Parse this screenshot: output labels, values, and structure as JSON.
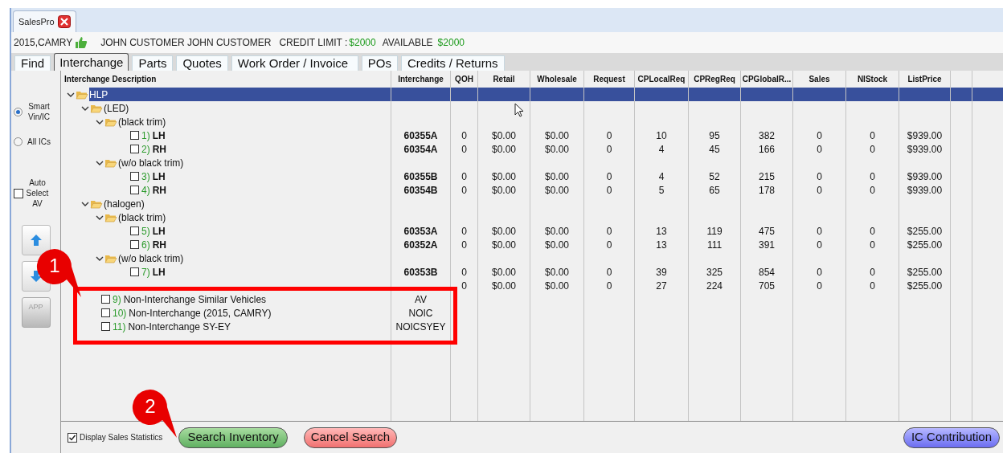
{
  "window_tab": {
    "title": "SalesPro"
  },
  "info_bar": {
    "vehicle": "2015,CAMRY",
    "customer": "JOHN CUSTOMER JOHN CUSTOMER",
    "credit_limit_label": "CREDIT LIMIT :",
    "credit_limit": "$2000",
    "available_label": "AVAILABLE",
    "available": "$2000"
  },
  "tabs": [
    {
      "label": "Find",
      "selected": false
    },
    {
      "label": "Interchange",
      "selected": true
    },
    {
      "label": "Parts",
      "selected": false
    },
    {
      "label": "Quotes",
      "selected": false
    },
    {
      "label": "Work Order / Invoice",
      "selected": false
    },
    {
      "label": "POs",
      "selected": false
    },
    {
      "label": "Credits / Returns",
      "selected": false
    }
  ],
  "sidebar": {
    "modes": [
      {
        "label": "Smart Vin/IC",
        "selected": true
      },
      {
        "label": "All ICs",
        "selected": false
      }
    ],
    "auto_select": {
      "label": "Auto Select AV",
      "checked": false
    },
    "buttons": [
      {
        "kind": "up"
      },
      {
        "kind": "down"
      },
      {
        "kind": "app",
        "label": "APP",
        "disabled": true
      }
    ]
  },
  "table": {
    "columns": [
      "Interchange Description",
      "Interchange",
      "QOH",
      "Retail",
      "Wholesale",
      "Request",
      "CPLocalReq",
      "CPRegReq",
      "CPGlobalR...",
      "Sales",
      "NIStock",
      "ListPrice"
    ],
    "rows": [
      {
        "kind": "group",
        "label": "HLP",
        "expanded": true,
        "selected": true,
        "children": [
          {
            "kind": "group",
            "label": "(LED)",
            "expanded": true,
            "selected": false,
            "children": [
              {
                "kind": "group",
                "label": "(black trim)",
                "expanded": true,
                "selected": false,
                "children": [
                  {
                    "kind": "part",
                    "number": "1)",
                    "label": "LH",
                    "checked": false,
                    "selected": false,
                    "interchange": "60355A",
                    "values": [
                      "0",
                      "$0.00",
                      "$0.00",
                      "0",
                      "10",
                      "95",
                      "382",
                      "0",
                      "0",
                      "$939.00"
                    ]
                  },
                  {
                    "kind": "part",
                    "number": "2)",
                    "label": "RH",
                    "checked": false,
                    "selected": false,
                    "interchange": "60354A",
                    "values": [
                      "0",
                      "$0.00",
                      "$0.00",
                      "0",
                      "4",
                      "45",
                      "166",
                      "0",
                      "0",
                      "$939.00"
                    ]
                  }
                ]
              },
              {
                "kind": "group",
                "label": "(w/o black trim)",
                "expanded": true,
                "selected": false,
                "children": [
                  {
                    "kind": "part",
                    "number": "3)",
                    "label": "LH",
                    "checked": false,
                    "selected": false,
                    "interchange": "60355B",
                    "values": [
                      "0",
                      "$0.00",
                      "$0.00",
                      "0",
                      "4",
                      "52",
                      "215",
                      "0",
                      "0",
                      "$939.00"
                    ]
                  },
                  {
                    "kind": "part",
                    "number": "4)",
                    "label": "RH",
                    "checked": false,
                    "selected": false,
                    "interchange": "60354B",
                    "values": [
                      "0",
                      "$0.00",
                      "$0.00",
                      "0",
                      "5",
                      "65",
                      "178",
                      "0",
                      "0",
                      "$939.00"
                    ]
                  }
                ]
              }
            ]
          },
          {
            "kind": "group",
            "label": "(halogen)",
            "expanded": true,
            "selected": false,
            "children": [
              {
                "kind": "group",
                "label": "(black trim)",
                "expanded": true,
                "selected": false,
                "children": [
                  {
                    "kind": "part",
                    "number": "5)",
                    "label": "LH",
                    "checked": false,
                    "selected": false,
                    "interchange": "60353A",
                    "values": [
                      "0",
                      "$0.00",
                      "$0.00",
                      "0",
                      "13",
                      "119",
                      "475",
                      "0",
                      "0",
                      "$255.00"
                    ]
                  },
                  {
                    "kind": "part",
                    "number": "6)",
                    "label": "RH",
                    "checked": false,
                    "selected": false,
                    "interchange": "60352A",
                    "values": [
                      "0",
                      "$0.00",
                      "$0.00",
                      "0",
                      "13",
                      "111",
                      "391",
                      "0",
                      "0",
                      "$255.00"
                    ]
                  }
                ]
              },
              {
                "kind": "group",
                "label": "(w/o black trim)",
                "expanded": true,
                "selected": false,
                "children": [
                  {
                    "kind": "part",
                    "number": "7)",
                    "label": "LH",
                    "checked": false,
                    "selected": false,
                    "interchange": "60353B",
                    "values": [
                      "0",
                      "$0.00",
                      "$0.00",
                      "0",
                      "39",
                      "325",
                      "854",
                      "0",
                      "0",
                      "$255.00"
                    ]
                  },
                  {
                    "kind": "part",
                    "selected": false,
                    "values": [
                      "0",
                      "$0.00",
                      "$0.00",
                      "0",
                      "27",
                      "224",
                      "705",
                      "0",
                      "0",
                      "$255.00"
                    ]
                  }
                ]
              }
            ]
          },
          {
            "kind": "non_interchange",
            "number": "9)",
            "label": "Non-Interchange Similar Vehicles",
            "checked": false,
            "selected": false,
            "interchange": "AV"
          },
          {
            "kind": "non_interchange",
            "number": "10)",
            "label": "Non-Interchange (2015, CAMRY)",
            "checked": false,
            "selected": false,
            "interchange": "NOIC"
          },
          {
            "kind": "non_interchange",
            "number": "11)",
            "label": "Non-Interchange SY-EY",
            "checked": false,
            "selected": false,
            "interchange": "NOICSYEY"
          }
        ]
      }
    ]
  },
  "footer": {
    "display_stats": {
      "label": "Display Sales Statistics",
      "checked": true
    },
    "buttons": [
      {
        "kind": "search",
        "label": "Search Inventory"
      },
      {
        "kind": "cancel",
        "label": "Cancel Search"
      },
      {
        "kind": "contribution",
        "label": "IC Contribution"
      }
    ]
  },
  "annotations": [
    {
      "number": "1"
    },
    {
      "number": "2"
    }
  ]
}
